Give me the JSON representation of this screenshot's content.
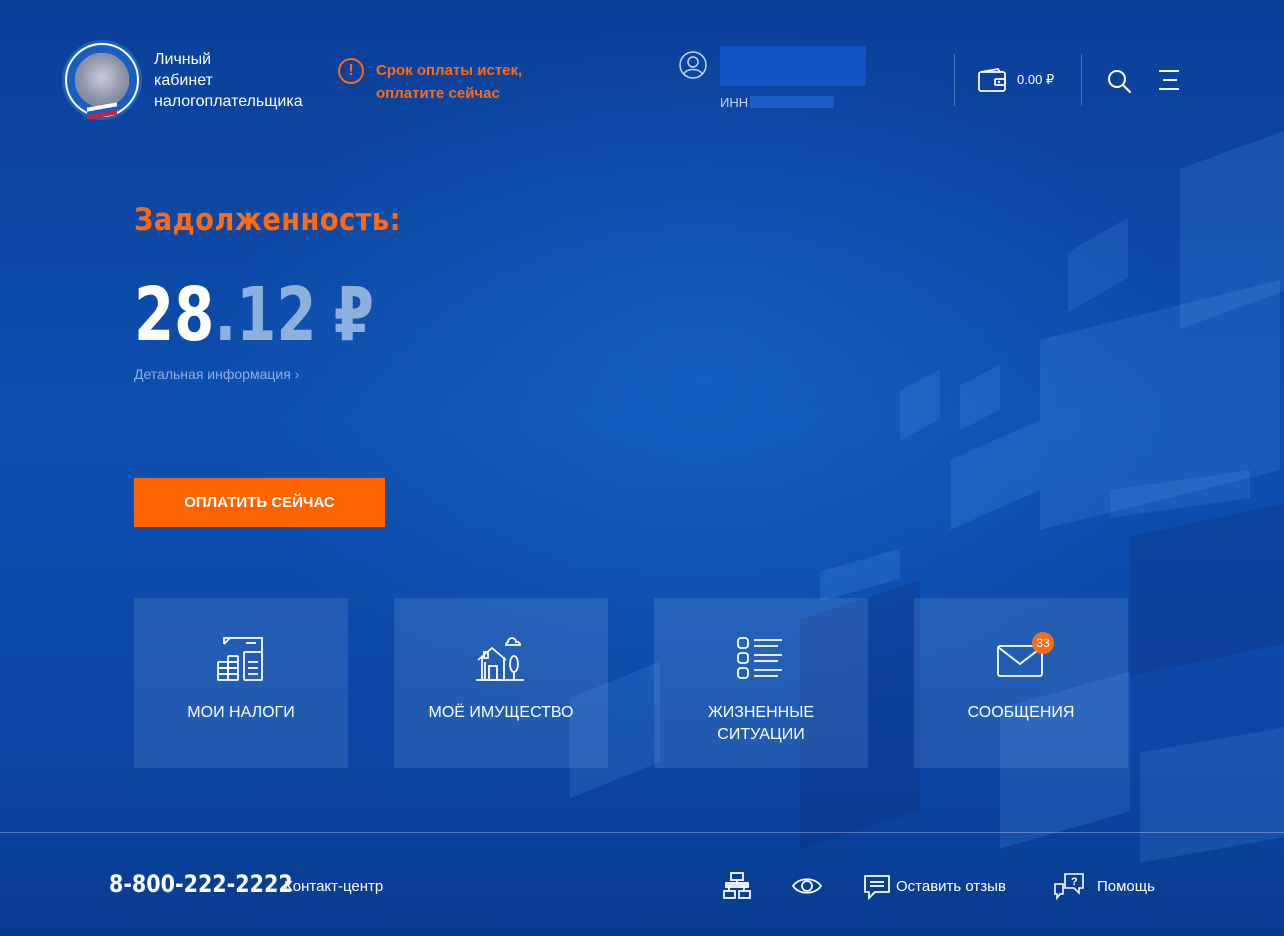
{
  "header": {
    "brand_lines": [
      "Личный",
      "кабинет",
      "налогоплательщика"
    ],
    "alert_text_lines": [
      "Срок оплаты истек,",
      "оплатите сейчас"
    ],
    "inn_label": "ИНН",
    "wallet_balance": "0.00 ₽"
  },
  "hero": {
    "debt_label": "Задолженность:",
    "amount_int": "28",
    "amount_dec": ".12",
    "currency": "₽",
    "details_link": "Детальная информация ›",
    "pay_button": "ОПЛАТИТЬ СЕЙЧАС"
  },
  "tiles": [
    {
      "label": "МОИ НАЛОГИ",
      "icon": "taxes-icon"
    },
    {
      "label": "МОЁ ИМУЩЕСТВО",
      "icon": "property-icon"
    },
    {
      "label": "ЖИЗНЕННЫЕ СИТУАЦИИ",
      "icon": "life-situations-icon"
    },
    {
      "label": "СООБЩЕНИЯ",
      "icon": "envelope-icon",
      "badge": "33"
    }
  ],
  "footer": {
    "phone": "8-800-222-2222",
    "contact_label": "Контакт-центр",
    "feedback_label": "Оставить отзыв",
    "help_label": "Помощь"
  },
  "colors": {
    "accent": "#ff6a13",
    "background": "#0c4aa6",
    "tile": "#3f6fbf"
  }
}
